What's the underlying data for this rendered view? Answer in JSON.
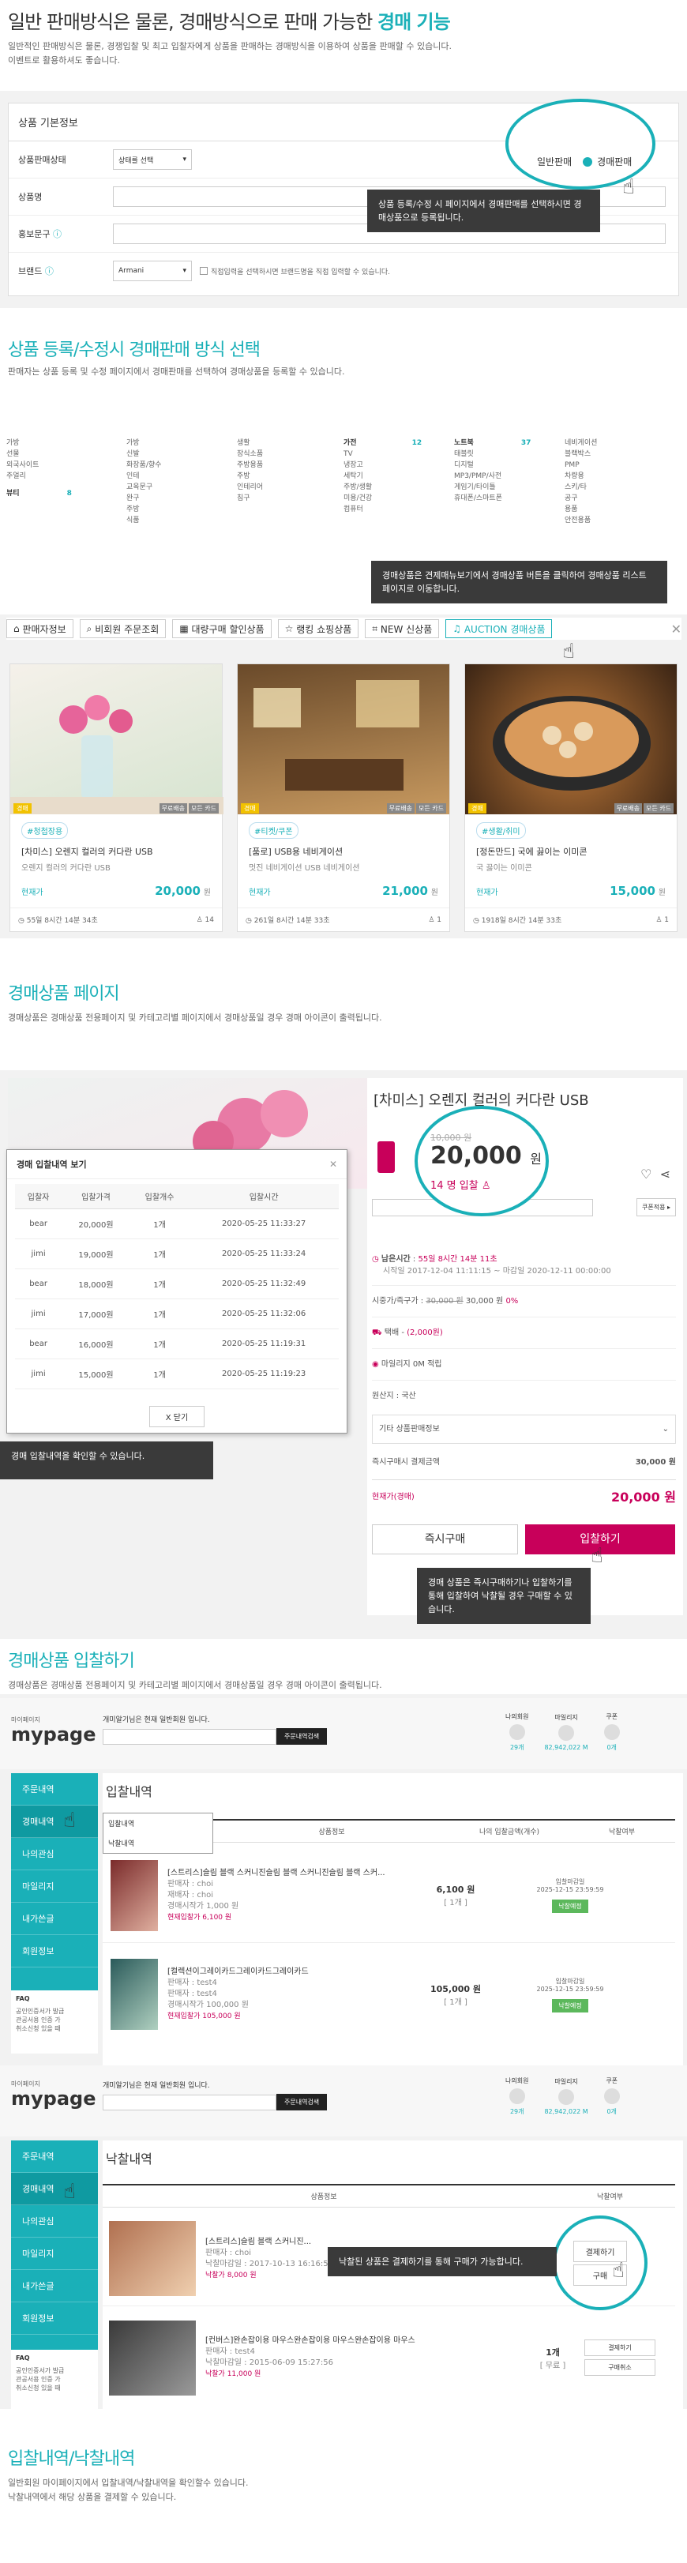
{
  "intro": {
    "title_main": "일반 판매방식은 물론, 경매방식으로 판매 가능한 ",
    "title_accent": "경매 기능",
    "desc1": "일반적인 판매방식은 물론, 경쟁입찰 및 최고 입찰자에게 상품을 판매하는 경매방식을 이용하여 상품을 판매할 수 있습니다.",
    "desc2": "이벤트로 활용하셔도 좋습니다."
  },
  "form": {
    "title": "상품 기본정보",
    "sale_status_label": "상품판매상태",
    "sale_status_value": "상태를 선택",
    "product_name_label": "상품명",
    "promo_label": "홍보문구",
    "brand_label": "브랜드",
    "brand_value": "Armani",
    "brand_note": "직접입력을 선택하시면 브랜드명을 직접 입력할 수 있습니다.",
    "toggle_normal": "일반판매",
    "toggle_auction": "경매판매",
    "tip": "상품 등록/수정 시 페이지에서 경매판매를 선택하시면 경매상품으로 등록됩니다."
  },
  "sec2": {
    "title": "상품 등록/수정시 경매판매 방식 선택",
    "desc": "판매자는 상품 등록 및 수정 페이지에서 경매판매를 선택하여 경매상품을 등록할 수 있습니다.",
    "cats": [
      [
        "가방",
        "선물",
        "외국사이트",
        "주얼리"
      ],
      [
        "가방",
        "신발",
        "화장품/향수",
        "인테",
        "교육문구",
        "완구",
        "주방",
        "식품"
      ],
      [
        "생활",
        "장식소품",
        "주방용품",
        "주방",
        "인테리어",
        "침구"
      ],
      [
        "TV",
        "냉장고",
        "세탁기",
        "주방/생활",
        "미용/건강",
        "컴퓨터"
      ],
      [
        "노트북",
        "태블릿",
        "디지털",
        "MP3/PMP/사전",
        "게임기/타이틀",
        "휴대폰/스마트폰"
      ],
      [
        "네비게이션",
        "블랙박스",
        "PMP",
        "차량용",
        "스키/타",
        "공구",
        "용품",
        "안전용품"
      ]
    ],
    "cat_heads": [
      "뷰티",
      "가전"
    ],
    "cat_counts": [
      "8",
      "12",
      "37"
    ],
    "tip": "경매상품은 견제매뉴보기에서 경매상품 버튼을 클릭하여 경매상품 리스트 페이지로 이동합니다.",
    "tabs": [
      "판매자정보",
      "비회원 주문조회",
      "대량구매 할인상품",
      "랭킹 쇼핑상품",
      "NEW 신상품",
      "AUCTION 경매상품"
    ],
    "products": [
      {
        "badge": "경매",
        "tag": "#청첩장용",
        "name": "[차미스] 오렌지 컬러의 커다란 USB",
        "sub": "오렌지 컬러의 커다란 USB",
        "price": "20,000",
        "unit": "원",
        "bid_label": "현재가",
        "time": "55일 8시간 14분 34초",
        "count": "14"
      },
      {
        "badge": "경매",
        "tag": "#티켓/쿠폰",
        "name": "[품로] USB용 네비게이션",
        "sub": "멋진 네비게이션 USB 네비게이션",
        "price": "21,000",
        "unit": "원",
        "bid_label": "현재가",
        "time": "261일 8시간 14분 33초",
        "count": "1"
      },
      {
        "badge": "경매",
        "tag": "#생활/취미",
        "name": "[정돈만드] 국에 끓이는 이미콘",
        "sub": "국 끓이는 이미콘",
        "price": "15,000",
        "unit": "원",
        "bid_label": "현재가",
        "time": "1918일 8시간 14분 33초",
        "count": "1"
      }
    ],
    "photo_badges": [
      "무료배송",
      "모든 카드"
    ]
  },
  "sec3": {
    "title": "경매상품 페이지",
    "desc": "경매상품은 경매상품 전용페이지 및 카테고리별 페이지에서 경매상품일 경우 경매 아이콘이 출력됩니다.",
    "product_title": "[차미스] 오렌지 컬러의 커다란 USB",
    "orig_price": "10,000 원",
    "cur_price": "20,000",
    "cur_unit": "원",
    "bidders": "14 명 입찰",
    "left_time_label": "남은시간",
    "left_time": "55일 8시간 14분 11초",
    "period": "시작일 2017-12-04 11:11:15 ~ 마감일 2020-12-11 00:00:00",
    "buy_now_label": "시중가/즉구가",
    "buy_now_strike": "30,000 원",
    "buy_now_price": "30,000 원",
    "buy_now_pct": "0%",
    "ship_label": "택배",
    "ship_value": "(2,000원)",
    "point_label": "마일리지 0M 적립",
    "origin": "원산지 : 국산",
    "option_label": "기타 상품판매정보",
    "total_label": "즉시구매시 결제금액",
    "total_value": "30,000 원",
    "cur_label": "현재가(경매)",
    "cur_value": "20,000 원",
    "btn_buy": "즉시구매",
    "btn_bid": "입찰하기",
    "tip_bid": "경매 상품은 즉시구매하기나 입찰하기를 통해 입찰하여 낙찰될 경우 구매할 수 있습니다.",
    "modal_title": "경매 입찰내역 보기",
    "modal_cols": [
      "입찰자",
      "입찰가격",
      "입찰개수",
      "입찰시간"
    ],
    "modal_rows": [
      [
        "bear",
        "20,000원",
        "1개",
        "2020-05-25 11:33:27"
      ],
      [
        "jimi",
        "19,000원",
        "1개",
        "2020-05-25 11:33:24"
      ],
      [
        "bear",
        "18,000원",
        "1개",
        "2020-05-25 11:32:49"
      ],
      [
        "jimi",
        "17,000원",
        "1개",
        "2020-05-25 11:32:06"
      ],
      [
        "bear",
        "16,000원",
        "1개",
        "2020-05-25 11:19:31"
      ],
      [
        "jimi",
        "15,000원",
        "1개",
        "2020-05-25 11:19:23"
      ]
    ],
    "modal_close": "X 닫기",
    "tip_modal": "경매 입찰내역을 확인할 수 있습니다."
  },
  "sec4": {
    "title": "경매상품 입찰하기",
    "desc": "경매상품은 경매상품 전용페이지 및 카테고리별 페이지에서 경매상품일 경우 경매 아이콘이 출력됩니다.",
    "mypage_small": "마이페이지",
    "mypage_logo": "mypage",
    "greet": "개미알기님은 현재 일반회원 입니다.",
    "search_btn": "주문내역검색",
    "stats": [
      {
        "label": "나의회원",
        "value": "29개"
      },
      {
        "label": "마일리지",
        "value": "82,942,022 M"
      },
      {
        "label": "쿠폰",
        "value": "0개"
      }
    ],
    "side": [
      "주문내역",
      "경매내역",
      "나의관심",
      "마일리지",
      "내가쓴글",
      "회원정보"
    ],
    "faq": "FAQ",
    "faq_items": [
      "공인인증서가 발급",
      "관공서용 인증 가",
      "취소신청 있을 때"
    ],
    "bid_title": "입찰내역",
    "dropdown": [
      "입찰내역",
      "낙찰내역"
    ],
    "cols": [
      "상품정보",
      "나의 입찰금액(개수)",
      "낙찰여부"
    ],
    "rows": [
      {
        "name": "[스트리스]슬림 블랙 스커니진슬림 블랙 스커니진슬림 블랙 스커...",
        "seller": "판매자 : choi",
        "meta": "재배자 : choi",
        "min": "경매시작가 1,000 원",
        "cur": "현재입찰가 6,100 원",
        "my": "6,100 원",
        "my_count": "[ 1개 ]",
        "end_label": "입찰마감일",
        "end": "2025-12-15 23:59:59",
        "status": "낙찰예정"
      },
      {
        "name": "[컬렉션이그레이카드그레이카드그레이카드",
        "seller": "판매자 : test4",
        "meta": "판매자 : test4",
        "min": "경매시작가 100,000 원",
        "cur": "현재입찰가 105,000 원",
        "my": "105,000 원",
        "my_count": "[ 1개 ]",
        "end_label": "입찰마감일",
        "end": "2025-12-15 23:59:59",
        "status": "낙찰예정"
      }
    ]
  },
  "sec5": {
    "won_title": "낙찰내역",
    "cols": [
      "상품정보",
      "낙찰여부"
    ],
    "rows": [
      {
        "name": "[스트리스]슬림 블랙 스커니진...",
        "seller": "판매자 : choi",
        "date": "낙찰마감일 : 2017-10-13 16:16:52",
        "price": "낙찰가 8,000 원"
      },
      {
        "name": "[컨버스]완손잡이용 마우스완손잡이용 마우스완손잡이용 마우스",
        "seller": "판매자 : test4",
        "date": "낙찰마감일 : 2015-06-09 15:27:56",
        "price": "낙찰가 11,000 원",
        "count": "1개",
        "count_sub": "[ 무료 ]"
      }
    ],
    "pay_btn": "결제하기",
    "buy_btn": "구매",
    "side_btn1": "결제하기",
    "side_btn2": "구매취소",
    "tip": "낙찰된 상품은 결제하기를 통해 구매가 가능합니다."
  },
  "sec6": {
    "title": "입찰내역/낙찰내역",
    "desc1": "일반회원 마이페이지에서 입찰내역/낙찰내역을 확인할수 있습니다.",
    "desc2": "낙찰내역에서 해당 상품을 결제할 수 있습니다."
  },
  "icons": {
    "hand": "hand-pointer-icon",
    "heart": "heart-icon",
    "share": "share-icon",
    "close": "close-icon",
    "user": "user-icon",
    "clock": "clock-icon",
    "truck": "truck-icon",
    "point": "coin-icon",
    "info": "info-icon",
    "bell": "bell-icon",
    "search": "search-icon",
    "chevron": "chevron-down-icon"
  },
  "colors": {
    "accent": "#1ab0b8",
    "bid": "#c8005a",
    "price": "#c8005a",
    "tip_bg": "#3a3a3a"
  }
}
